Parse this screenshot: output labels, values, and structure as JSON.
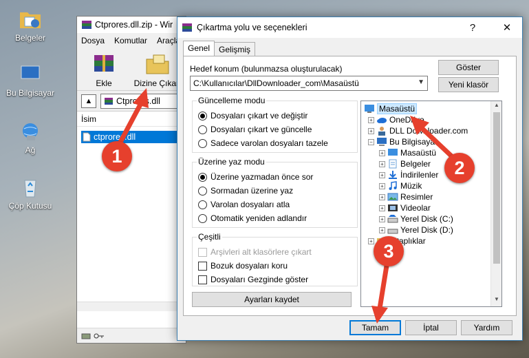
{
  "desktop": {
    "icons": [
      {
        "label": "Belgeler",
        "icon": "documents-folder-icon"
      },
      {
        "label": "Bu Bilgisayar",
        "icon": "computer-icon"
      },
      {
        "label": "Ağ",
        "icon": "network-icon"
      },
      {
        "label": "Çöp Kutusu",
        "icon": "recycle-bin-icon"
      }
    ]
  },
  "winrar": {
    "title": "Ctprores.dll.zip - Wir",
    "menu": [
      "Dosya",
      "Komutlar",
      "Araçla"
    ],
    "tools": [
      {
        "label": "Ekle",
        "icon": "add-archive-icon"
      },
      {
        "label": "Dizine Çıkart",
        "icon": "extract-to-icon"
      }
    ],
    "path": "Ctprores.dll",
    "column": "İsim",
    "file": "ctprores.dll"
  },
  "dialog": {
    "title": "Çıkartma yolu ve seçenekleri",
    "help": "?",
    "close": "✕",
    "tabs": [
      "Genel",
      "Gelişmiş"
    ],
    "dest_label": "Hedef konum (bulunmazsa oluşturulacak)",
    "dest_value": "C:\\Kullanıcılar\\DllDownloader_com\\Masaüstü",
    "show_button": "Göster",
    "new_folder_button": "Yeni klasör",
    "update_group": {
      "title": "Güncelleme modu",
      "options": [
        "Dosyaları çıkart ve değiştir",
        "Dosyaları çıkart ve güncelle",
        "Sadece varolan dosyaları tazele"
      ],
      "selected": 0
    },
    "overwrite_group": {
      "title": "Üzerine yaz modu",
      "options": [
        "Üzerine yazmadan önce sor",
        "Sormadan üzerine yaz",
        "Varolan dosyaları atla",
        "Otomatik yeniden adlandır"
      ],
      "selected": 0
    },
    "misc_group": {
      "title": "Çeşitli",
      "options": [
        "Arşivleri alt klasörlere çıkart",
        "Bozuk dosyaları koru",
        "Dosyaları Gezginde göster"
      ],
      "disabled_index": 0
    },
    "save_settings_button": "Ayarları kaydet",
    "tree": [
      {
        "label": "Masaüstü",
        "icon": "desktop-icon",
        "selected": true
      },
      {
        "label": "OneDrive",
        "icon": "onedrive-icon"
      },
      {
        "label": "DLL Downloader.com",
        "icon": "user-icon"
      },
      {
        "label": "Bu Bilgisayar",
        "icon": "computer-icon"
      },
      {
        "label": "Masaüstü",
        "icon": "desktop-icon"
      },
      {
        "label": "Belgeler",
        "icon": "documents-icon"
      },
      {
        "label": "İndirilenler",
        "icon": "downloads-icon"
      },
      {
        "label": "Müzik",
        "icon": "music-icon"
      },
      {
        "label": "Resimler",
        "icon": "pictures-icon"
      },
      {
        "label": "Videolar",
        "icon": "videos-icon"
      },
      {
        "label": "Yerel Disk (C:)",
        "icon": "drive-icon"
      },
      {
        "label": "Yerel Disk (D:)",
        "icon": "drive-icon"
      },
      {
        "label": "Kitaplıklar",
        "icon": "libraries-icon"
      }
    ],
    "ok_button": "Tamam",
    "cancel_button": "İptal",
    "help_button": "Yardım"
  },
  "callouts": [
    "1",
    "2",
    "3"
  ],
  "colors": {
    "callout": "#e6402d",
    "selection": "#0078d7"
  }
}
